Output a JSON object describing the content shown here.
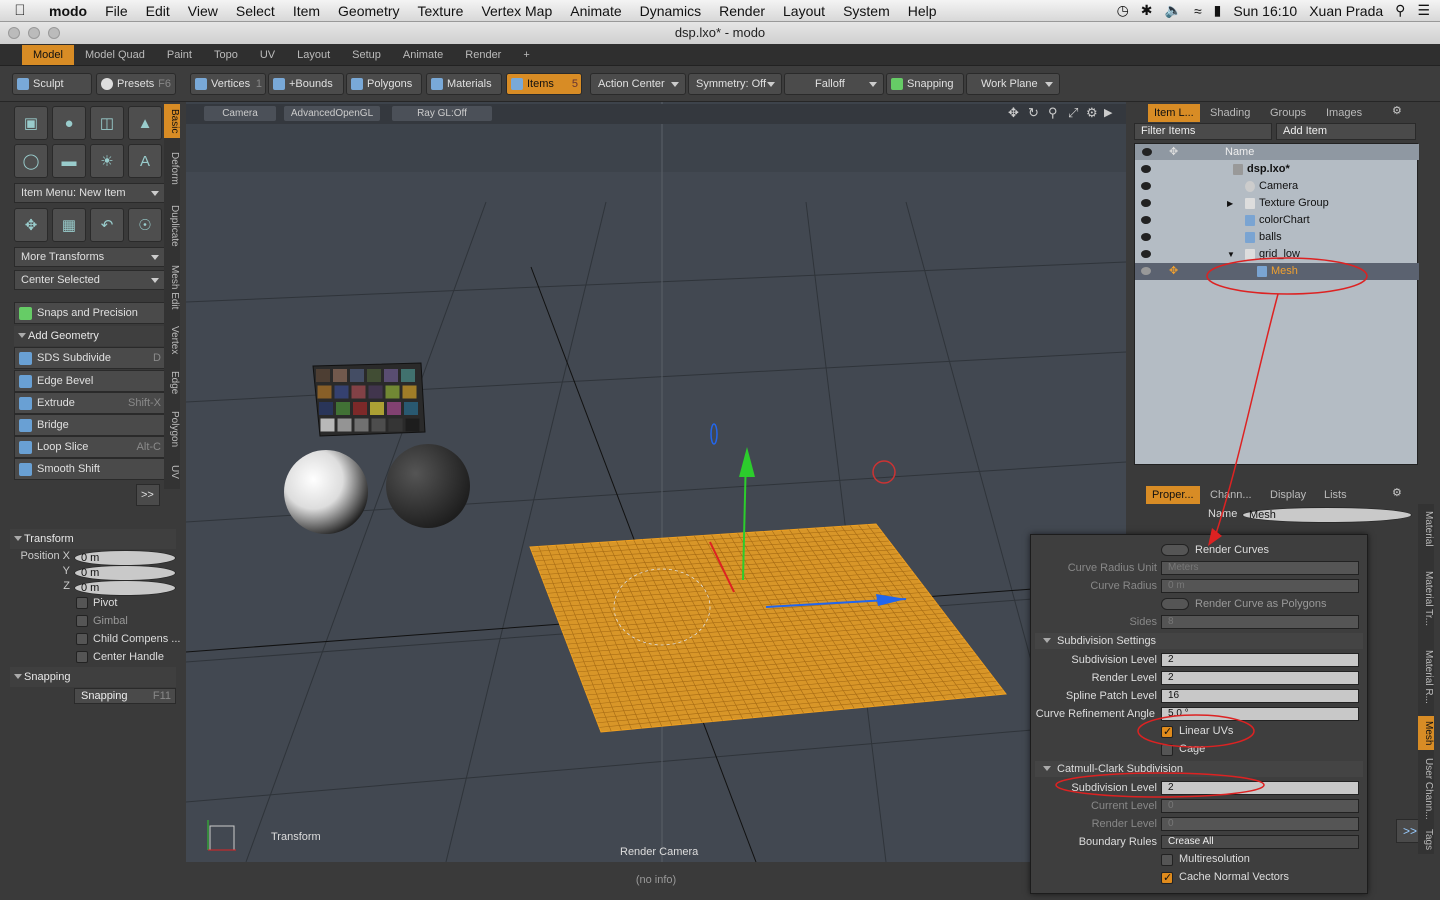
{
  "menubar": {
    "app": "modo",
    "items": [
      "File",
      "Edit",
      "View",
      "Select",
      "Item",
      "Geometry",
      "Texture",
      "Vertex Map",
      "Animate",
      "Dynamics",
      "Render",
      "Layout",
      "System",
      "Help"
    ],
    "clock": "Sun 16:10",
    "user": "Xuan Prada"
  },
  "window": {
    "title": "dsp.lxo* - modo"
  },
  "layout_tabs": [
    "Model",
    "Model Quad",
    "Paint",
    "Topo",
    "UV",
    "Layout",
    "Setup",
    "Animate",
    "Render"
  ],
  "toolbar": {
    "sculpt": "Sculpt",
    "presets": "Presets",
    "presets_key": "F6",
    "vertices": "Vertices",
    "vertices_key": "1",
    "bounds": "+Bounds",
    "polygons": "Polygons",
    "materials": "Materials",
    "items": "Items",
    "items_key": "5",
    "action_center": "Action Center",
    "symmetry": "Symmetry: Off",
    "falloff": "Falloff",
    "snapping": "Snapping",
    "work_plane": "Work Plane"
  },
  "left_panel": {
    "item_menu": "Item Menu: New Item",
    "more_transforms": "More Transforms",
    "center_selected": "Center Selected",
    "snaps": "Snaps and Precision",
    "add_geometry": "Add Geometry",
    "tools": [
      {
        "label": "SDS Subdivide",
        "key": "D"
      },
      {
        "label": "Edge Bevel",
        "key": ""
      },
      {
        "label": "Extrude",
        "key": "Shift-X"
      },
      {
        "label": "Bridge",
        "key": ""
      },
      {
        "label": "Loop Slice",
        "key": "Alt-C"
      },
      {
        "label": "Smooth Shift",
        "key": ""
      }
    ],
    "more_button": ">>",
    "side_tabs": [
      "Basic",
      "Deform",
      "Duplicate",
      "Mesh Edit",
      "Vertex",
      "Edge",
      "Polygon",
      "UV"
    ]
  },
  "transform_panel": {
    "title": "Transform",
    "position_label": "Position X",
    "y_label": "Y",
    "z_label": "Z",
    "x": "0 m",
    "y": "0 m",
    "z": "0 m",
    "pivot": "Pivot",
    "gimbal": "Gimbal",
    "child_compensation": "Child Compens ...",
    "center_handle": "Center Handle",
    "snapping_section": "Snapping",
    "snapping_button": "Snapping",
    "snapping_key": "F11"
  },
  "viewport": {
    "tabs": [
      "Camera",
      "AdvancedOpenGL",
      "Ray GL:Off"
    ],
    "transform_label": "Transform",
    "camera_label": "Render Camera",
    "status": "(no info)"
  },
  "item_list": {
    "tabs": [
      "Item L...",
      "Shading",
      "Groups",
      "Images"
    ],
    "filter": "Filter Items",
    "add_item": "Add Item",
    "column": "Name",
    "rows": [
      {
        "label": "dsp.lxo*"
      },
      {
        "label": "Camera"
      },
      {
        "label": "Texture Group"
      },
      {
        "label": "colorChart"
      },
      {
        "label": "balls"
      },
      {
        "label": "grid_low"
      },
      {
        "label": "Mesh"
      }
    ]
  },
  "properties": {
    "tabs": [
      "Proper...",
      "Chann...",
      "Display",
      "Lists"
    ],
    "name_label": "Name",
    "name_value": "Mesh",
    "side_tabs": [
      "Material",
      "Material Tr...",
      "Material R...",
      "Mesh",
      "User Chann...",
      "Tags"
    ],
    "more_button": ">>"
  },
  "popup": {
    "render_curves": "Render Curves",
    "curve_radius_unit_label": "Curve Radius Unit",
    "curve_radius_unit": "Meters",
    "curve_radius_label": "Curve Radius",
    "curve_radius": "0 m",
    "render_curve_polygons": "Render Curve as Polygons",
    "sides_label": "Sides",
    "sides": "8",
    "subdivision_settings": "Subdivision Settings",
    "subdiv_level_label": "Subdivision Level",
    "subdiv_level": "2",
    "render_level_label": "Render Level",
    "render_level": "2",
    "spline_patch_label": "Spline Patch Level",
    "spline_patch": "16",
    "curve_refinement_label": "Curve Refinement Angle",
    "curve_refinement": "5.0 °",
    "linear_uvs": "Linear UVs",
    "cage": "Cage",
    "catmull_clark": "Catmull-Clark Subdivision",
    "cc_subdiv_label": "Subdivision Level",
    "cc_subdiv": "2",
    "current_level_label": "Current Level",
    "current_level": "0",
    "cc_render_level_label": "Render Level",
    "cc_render_level": "0",
    "boundary_rules_label": "Boundary Rules",
    "boundary_rules": "Crease All",
    "multiresolution": "Multiresolution",
    "cache_normal": "Cache Normal Vectors"
  },
  "colors": {
    "accent": "#d88c25",
    "grid": "#f0a020",
    "viewport": "#424851",
    "annotation": "#dd2222"
  }
}
